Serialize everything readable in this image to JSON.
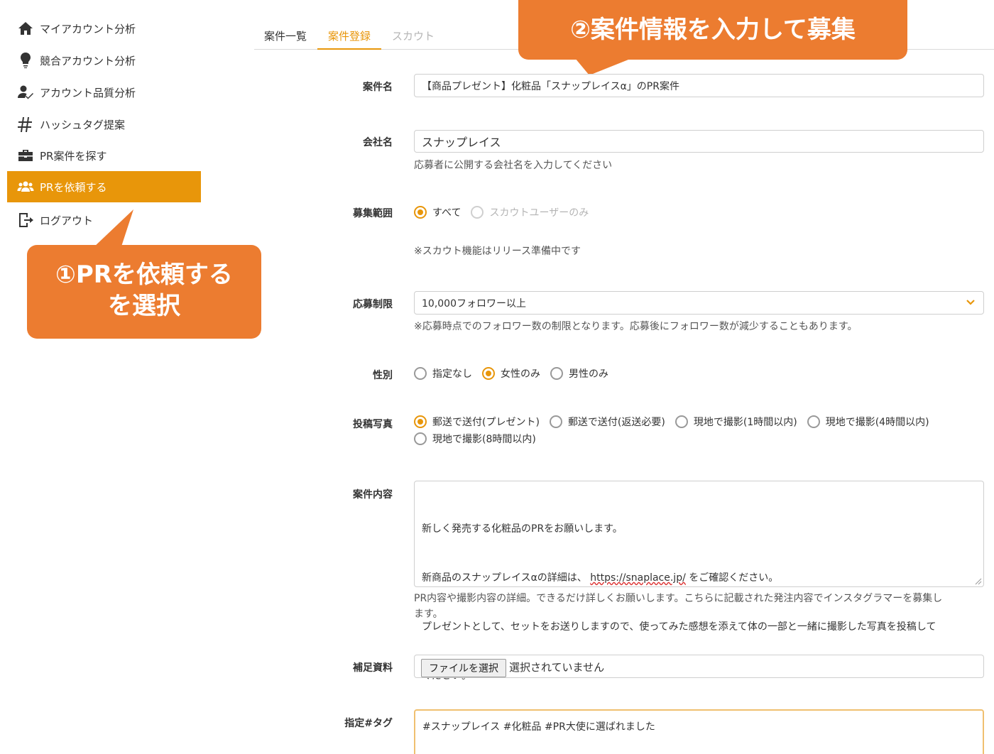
{
  "sidebar": {
    "items": [
      {
        "label": "マイアカウント分析",
        "icon": "home-icon"
      },
      {
        "label": "競合アカウント分析",
        "icon": "lightbulb-icon"
      },
      {
        "label": "アカウント品質分析",
        "icon": "user-check-icon"
      },
      {
        "label": "ハッシュタグ提案",
        "icon": "hashtag-icon"
      },
      {
        "label": "PR案件を探す",
        "icon": "briefcase-icon"
      },
      {
        "label": "PRを依頼する",
        "icon": "users-icon"
      },
      {
        "label": "ログアウト",
        "icon": "logout-icon"
      }
    ]
  },
  "tabs": [
    {
      "label": "案件一覧"
    },
    {
      "label": "案件登録"
    },
    {
      "label": "スカウト"
    }
  ],
  "form": {
    "title": {
      "label": "案件名",
      "value": "【商品プレゼント】化粧品「スナップレイスα」のPR案件"
    },
    "company": {
      "label": "会社名",
      "value": "スナップレイス",
      "help": "応募者に公開する会社名を入力してください"
    },
    "scope": {
      "label": "募集範囲",
      "options": [
        "すべて",
        "スカウトユーザーのみ"
      ],
      "help": "※スカウト機能はリリース準備中です"
    },
    "limit": {
      "label": "応募制限",
      "value": "10,000フォロワー以上",
      "help": "※応募時点でのフォロワー数の制限となります。応募後にフォロワー数が減少することもあります。"
    },
    "gender": {
      "label": "性別",
      "options": [
        "指定なし",
        "女性のみ",
        "男性のみ"
      ]
    },
    "photo": {
      "label": "投稿写真",
      "options": [
        "郵送で送付(プレゼント)",
        "郵送で送付(返送必要)",
        "現地で撮影(1時間以内)",
        "現地で撮影(4時間以内)",
        "現地で撮影(8時間以内)"
      ]
    },
    "content": {
      "label": "案件内容",
      "line1": "新しく発売する化粧品のPRをお願いします。",
      "line2_pre": "新商品のスナップレイスαの詳細は、 ",
      "line2_url": "https://snaplace.jp/",
      "line2_post": " をご確認ください。",
      "line3": "プレゼントとして、セットをお送りしますので、使ってみた感想を添えて体の一部と一緒に撮影した写真を投稿して",
      "line4": "ください。",
      "help1": "PR内容や撮影内容の詳細。できるだけ詳しくお願いします。こちらに記載された発注内容でインスタグラマーを募集し",
      "help2": "ます。"
    },
    "attachment": {
      "label": "補足資料",
      "button": "ファイルを選択",
      "status": "選択されていません"
    },
    "tags": {
      "label": "指定#タグ",
      "value": "#スナップレイス #化粧品 #PR大使に選ばれました"
    }
  },
  "callouts": {
    "one_line1": "①PRを依頼する",
    "one_line2": "を選択",
    "two": "②案件情報を入力して募集"
  },
  "colors": {
    "accent": "#e8960a",
    "callout": "#ec7c30"
  }
}
